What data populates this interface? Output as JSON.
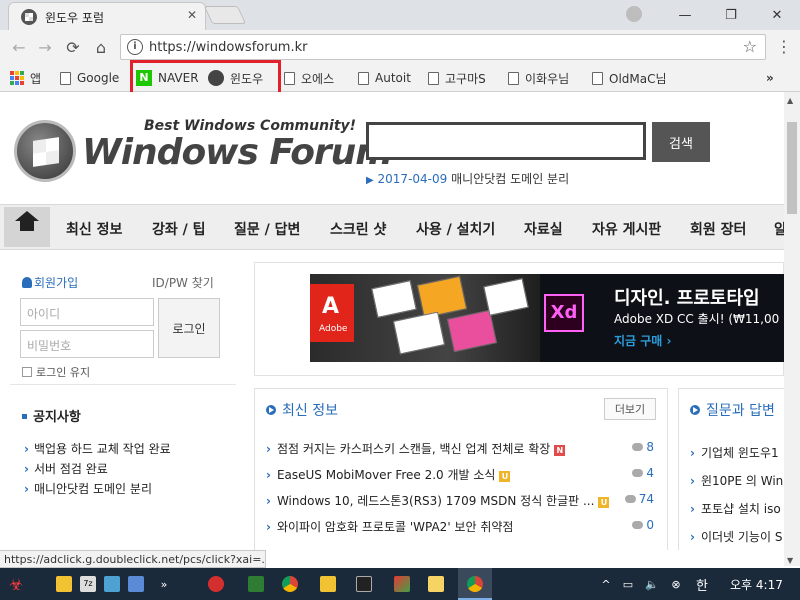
{
  "browser": {
    "tab_title": "윈도우 포럼",
    "url": "https://windowsforum.kr",
    "bookmarks": [
      "앱",
      "Google",
      "NAVER",
      "윈도우",
      "오에스",
      "Autoit",
      "고구마S",
      "이화우님",
      "OldMaC님"
    ],
    "more": "»"
  },
  "header": {
    "tagline": "Best Windows Community!",
    "logo_text": "Windows Forum",
    "search_button": "검색",
    "notice_date": "2017-04-09",
    "notice_text": "매니안닷컴 도메인 분리"
  },
  "nav": {
    "items": [
      "최신 정보",
      "강좌 / 팁",
      "질문 / 답변",
      "스크린 샷",
      "사용 / 설치기",
      "자료실",
      "자유 게시판",
      "회원 장터",
      "알"
    ]
  },
  "sidebar": {
    "signup": "회원가입",
    "idpw": "ID/PW 찾기",
    "id_placeholder": "아이디",
    "pw_placeholder": "비밀번호",
    "login_button": "로그인",
    "keep_login": "로그인 유지",
    "notice_title": "공지사항",
    "notices": [
      "백업용 하드 교체 작업 완료",
      "서버 점검 완료",
      "매니안닷컴 도메인 분리"
    ]
  },
  "banner": {
    "adobe": "Adobe",
    "xd": "Xd",
    "heading": "디자인. 프로토타입",
    "sub": "Adobe XD CC 출시! (₩11,00",
    "cta": "지금 구매 ›"
  },
  "latest": {
    "title": "최신 정보",
    "more_button": "더보기",
    "posts": [
      {
        "text": "점점 커지는 카스퍼스키 스캔들, 백신 업계 전체로 확장",
        "badge": "N",
        "count": "8"
      },
      {
        "text": "EaseUS MobiMover Free 2.0 개발 소식",
        "badge": "U",
        "count": "4"
      },
      {
        "text": "Windows 10, 레드스톤3(RS3) 1709 MSDN 정식 한글판 ...",
        "badge": "U",
        "count": "74"
      },
      {
        "text": "와이파이 암호화 프로토콜 'WPA2' 보안 취약점",
        "badge": "",
        "count": "0"
      }
    ]
  },
  "qna": {
    "title": "질문과 답변",
    "posts": [
      "기업체 윈도우1",
      "윈10PE 의 Win",
      "포토샵 설치 iso",
      "이더넷 기능이 S"
    ]
  },
  "status_url": "https://adclick.g.doubleclick.net/pcs/click?xai=...",
  "taskbar": {
    "time": "오후 4:17",
    "ime": "한"
  },
  "colors": {
    "accent": "#2a6ebb",
    "highlight_box": "#e0202a",
    "naver": "#1ec800"
  }
}
